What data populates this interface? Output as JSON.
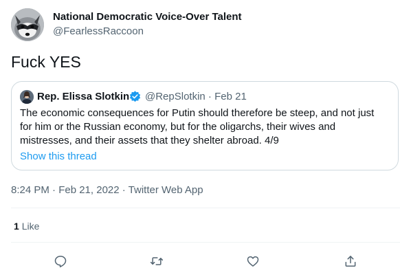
{
  "tweet": {
    "author": {
      "display_name": "National Democratic Voice-Over Talent",
      "handle": "@FearlessRaccoon",
      "avatar": "raccoon-avatar"
    },
    "text": "Fuck YES",
    "timestamp": "8:24 PM · Feb 21, 2022",
    "source": "Twitter Web App",
    "separator": " · ",
    "likes": {
      "count": "1",
      "label": "Like"
    }
  },
  "quoted_tweet": {
    "display_name": "Rep. Elissa Slotkin",
    "verified": true,
    "handle_date": "@RepSlotkin · Feb 21",
    "lines": [
      "The economic consequences for Putin should therefore be steep, and not just",
      "for him or the Russian economy, but for the oligarchs, their wives and",
      "mistresses, and their assets that they shelter abroad. 4/9"
    ],
    "show_thread": "Show this thread"
  },
  "actions": [
    "reply-icon",
    "retweet-icon",
    "like-icon",
    "share-icon"
  ],
  "colors": {
    "text": "#0f1419",
    "secondary": "#536471",
    "link": "#1d9bf0",
    "border": "#cfd9de",
    "divider": "#eff3f4",
    "verified": "#1d9bf0"
  }
}
